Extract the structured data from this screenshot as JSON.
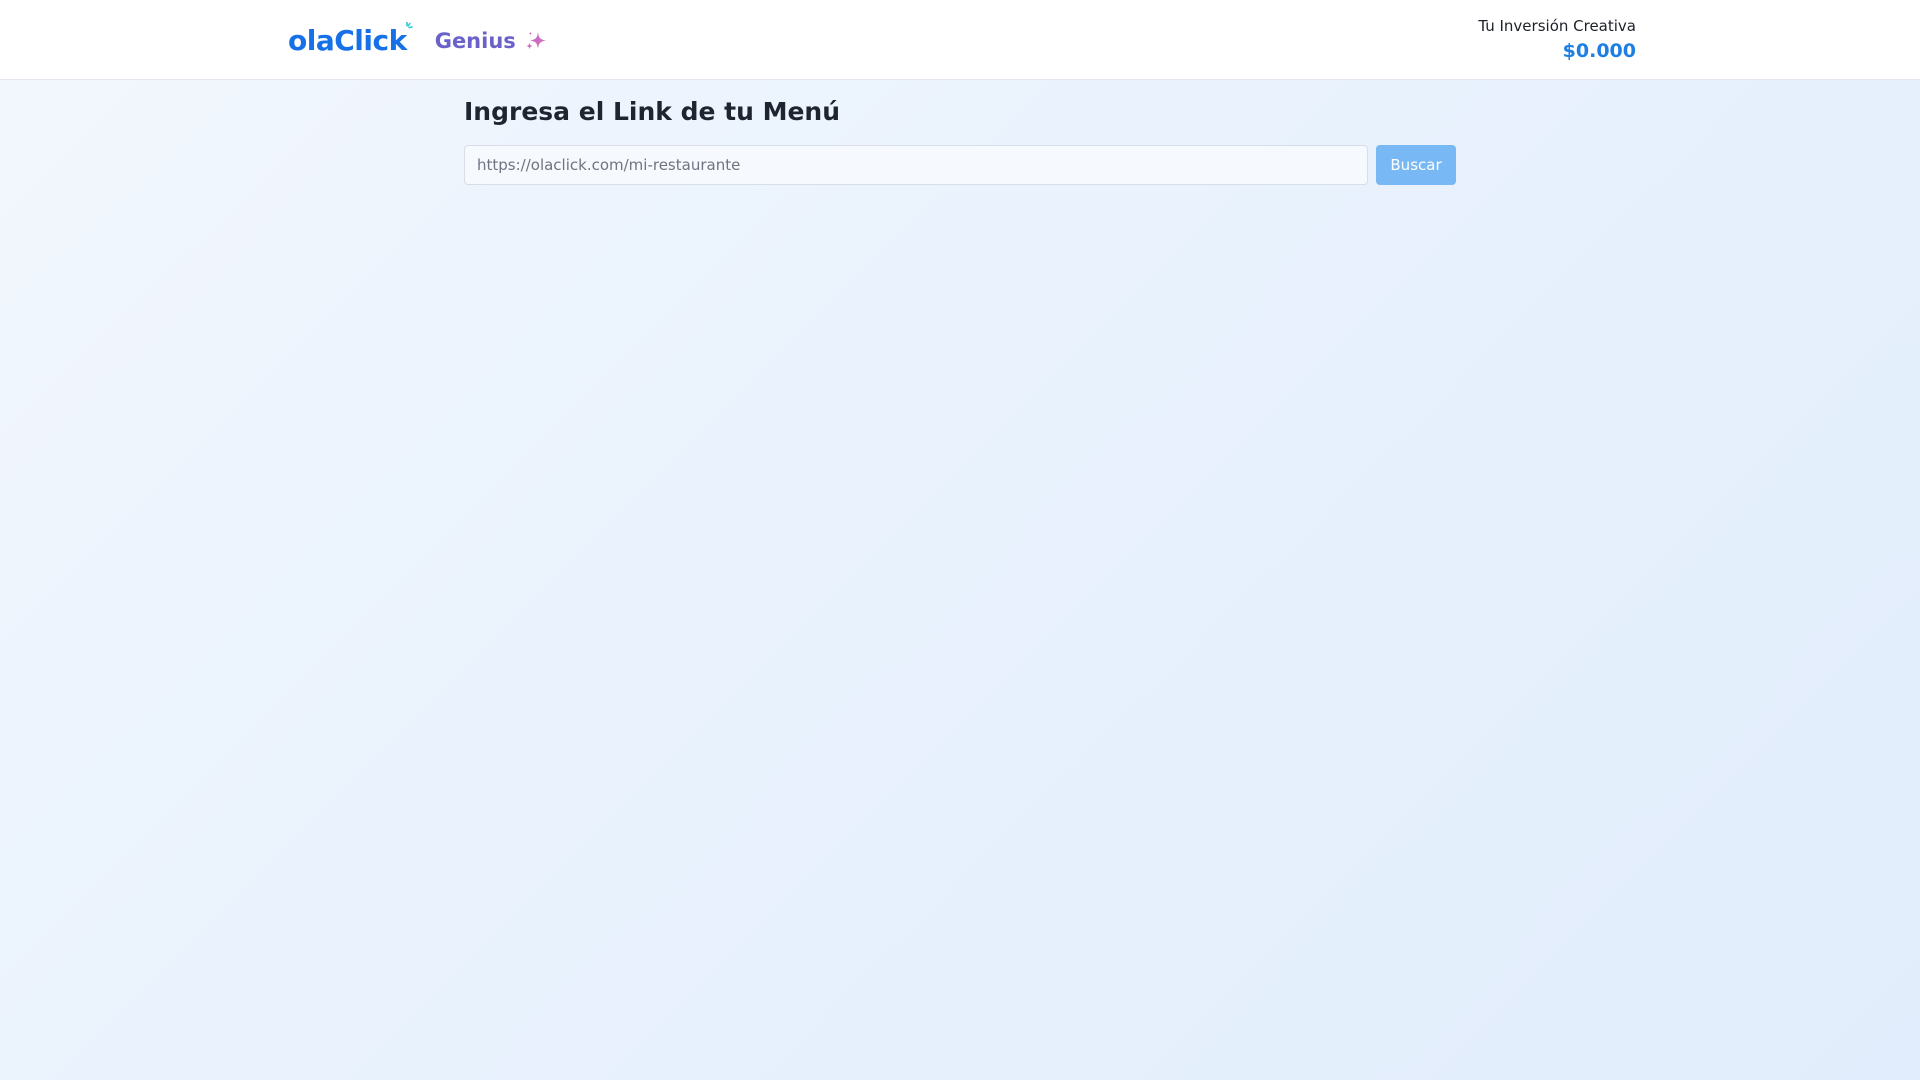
{
  "header": {
    "logo_text": "olaClick",
    "product_name": "Genius",
    "product_icon": "sparkles-icon",
    "investment_label": "Tu Inversión Creativa",
    "investment_value": "$0.000"
  },
  "main": {
    "title": "Ingresa el Link de tu Menú",
    "url_input": {
      "placeholder": "https://olaclick.com/mi-restaurante",
      "value": ""
    },
    "search_button_label": "Buscar"
  },
  "colors": {
    "brand_blue": "#1670e8",
    "genius_purple": "#6a62c9",
    "sparkle_pink": "#c86dc4",
    "value_blue": "#1d7fe3",
    "button_blue": "#78b8f4"
  }
}
